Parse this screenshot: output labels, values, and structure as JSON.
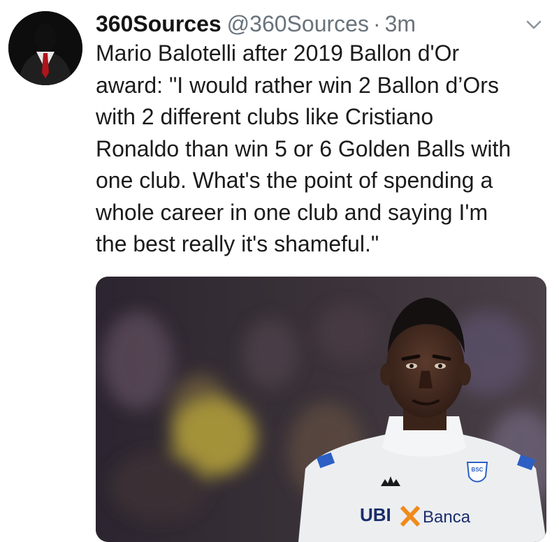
{
  "tweet": {
    "display_name": "360Sources",
    "handle": "@360Sources",
    "separator": "·",
    "timestamp": "3m",
    "text_lines": [
      "Mario Balotelli after 2019 Ballon d'Or",
      "award: \"I would rather win 2 Ballon d’Ors",
      "with 2 different clubs like Cristiano",
      "Ronaldo than win 5 or 6 Golden Balls with",
      "one club. What's the point of spending a",
      "whole career in one club and saying I'm",
      "the best really it's shameful.\""
    ]
  },
  "media": {
    "jersey_sponsor": "UBI",
    "jersey_sponsor_2": "Banca",
    "club_crest_text": "BSC"
  },
  "icons": {
    "caret": "chevron-down-icon",
    "avatar": "suited-figure-avatar"
  },
  "colors": {
    "name": "#141414",
    "secondary": "#69737c",
    "text": "#1b1b1b"
  }
}
